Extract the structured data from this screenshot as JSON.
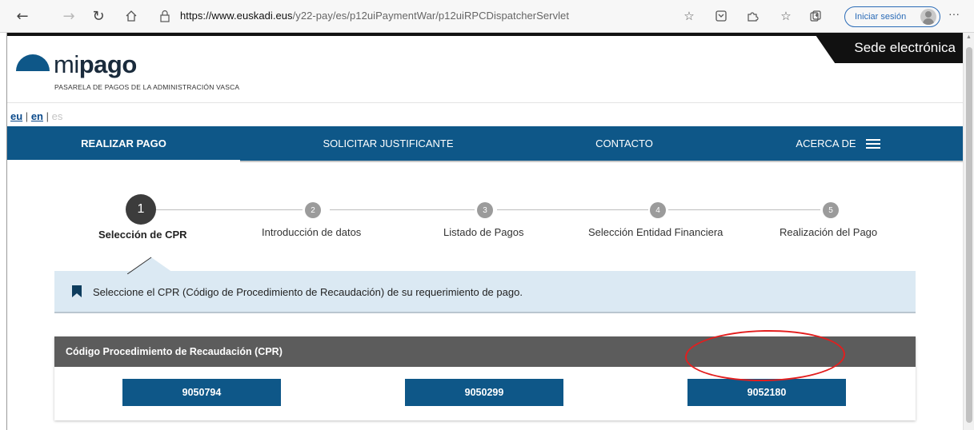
{
  "browser": {
    "url_host": "https://www.euskadi.eus",
    "url_path": "/y22-pay/es/p12uiPaymentWar/p12uiRPCDispatcherServlet",
    "signin_label": "Iniciar sesión",
    "more_label": "···",
    "icons": [
      "back-arrow-icon",
      "forward-arrow-icon",
      "refresh-icon",
      "home-icon",
      "lock-icon",
      "favorite-add-icon",
      "reading-view-icon",
      "extensions-icon",
      "favorites-icon",
      "collections-icon",
      "profile-icon"
    ]
  },
  "header": {
    "sede_label": "Sede electrónica",
    "logo_mi": "mi",
    "logo_pago": "pago",
    "logo_subtitle": "PASARELA DE PAGOS DE LA ADMINISTRACIÓN VASCA"
  },
  "languages": {
    "eu": "eu",
    "en": "en",
    "es": "es",
    "separator": "|"
  },
  "nav": {
    "items": [
      {
        "label": "REALIZAR PAGO"
      },
      {
        "label": "SOLICITAR JUSTIFICANTE"
      },
      {
        "label": "CONTACTO"
      },
      {
        "label": "ACERCA DE"
      }
    ]
  },
  "stepper": {
    "current_step": 1,
    "steps": [
      {
        "number": "1",
        "label": "Selección de CPR"
      },
      {
        "number": "2",
        "label": "Introducción de datos"
      },
      {
        "number": "3",
        "label": "Listado de Pagos"
      },
      {
        "number": "4",
        "label": "Selección Entidad Financiera"
      },
      {
        "number": "5",
        "label": "Realización del Pago"
      }
    ]
  },
  "info": {
    "text": "Seleccione el CPR (Código de Procedimiento de Recaudación) de su requerimiento de pago."
  },
  "cpr": {
    "header": "Código Procedimiento de Recaudación (CPR)",
    "options": [
      "9050794",
      "9050299",
      "9052180"
    ],
    "highlighted": "9052180"
  },
  "colors": {
    "primary": "#0e5788",
    "info_bg": "#dbe9f3",
    "card_header": "#5c5c5c",
    "highlight": "#e31e1e"
  }
}
